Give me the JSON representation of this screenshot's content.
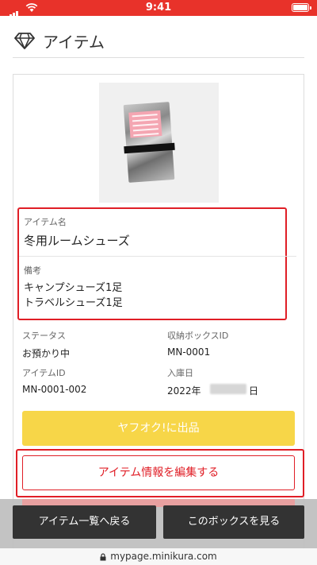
{
  "status_bar": {
    "time": "9:41",
    "background": "#e8322a"
  },
  "header": {
    "icon": "diamond-icon",
    "title": "アイテム"
  },
  "item": {
    "name_label": "アイテム名",
    "name": "冬用ルームシューズ",
    "note_label": "備考",
    "note_lines": [
      "キャンプシューズ1足",
      "トラベルシューズ1足"
    ]
  },
  "details": {
    "status_label": "ステータス",
    "status_value": "お預かり中",
    "box_id_label": "収納ボックスID",
    "box_id_value": "MN-0001",
    "item_id_label": "アイテムID",
    "item_id_value": "MN-0001-002",
    "entry_date_label": "入庫日",
    "entry_date_prefix": "2022年",
    "entry_date_suffix": "日"
  },
  "actions": {
    "yahoo_auction": "ヤフオク!に出品",
    "edit_item": "アイテム情報を編集する",
    "back_to_list": "アイテム一覧へ戻る",
    "view_box": "このボックスを見る"
  },
  "browser": {
    "url": "mypage.minikura.com"
  },
  "colors": {
    "accent_red": "#e01e26",
    "yahoo_yellow": "#f7d648",
    "dark_button": "#333333"
  }
}
